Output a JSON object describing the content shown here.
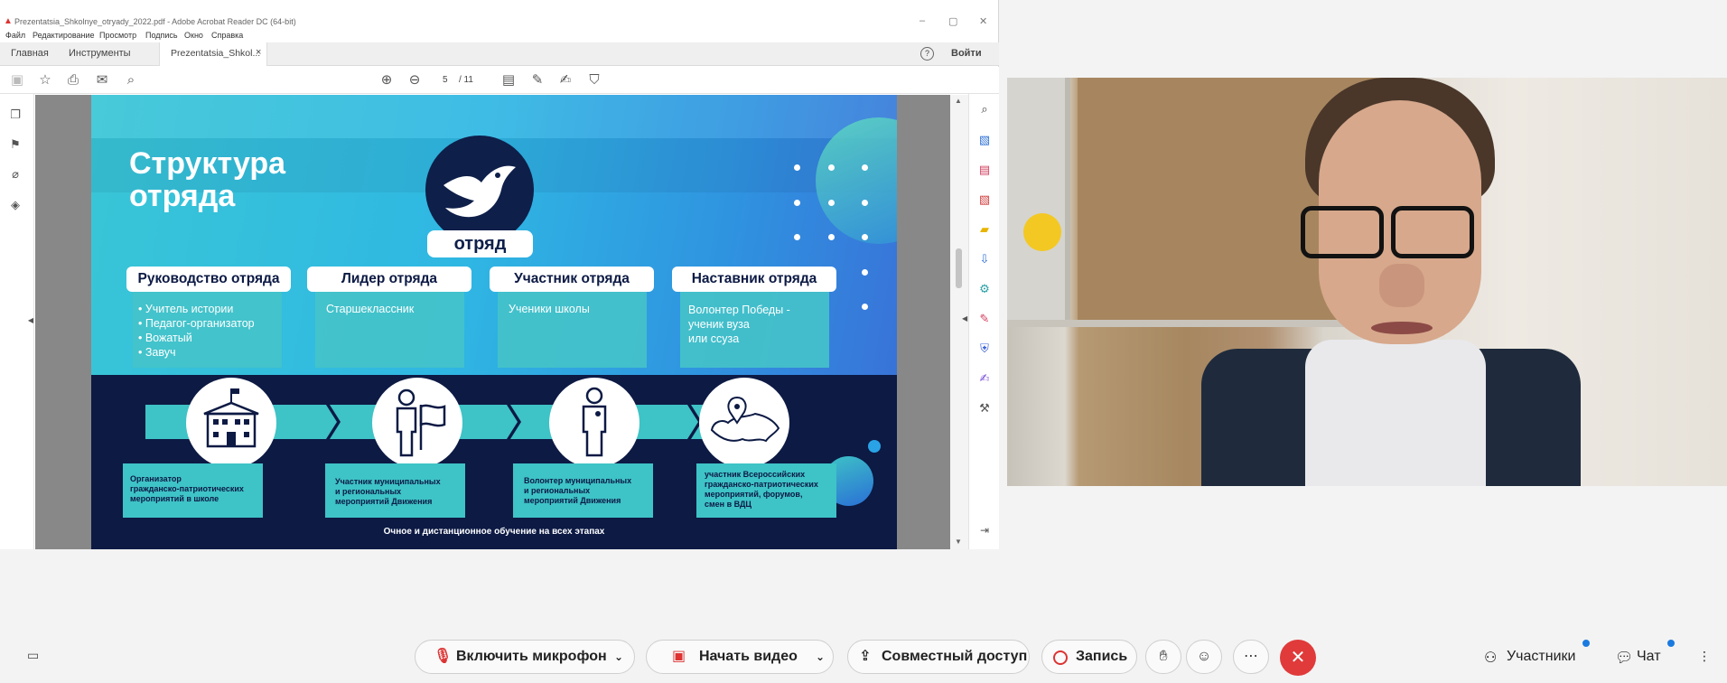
{
  "acrobat": {
    "window_title": "Prezentatsia_Shkolnye_otryady_2022.pdf - Adobe Acrobat Reader DC (64-bit)",
    "menu": [
      "Файл",
      "Редактирование",
      "Просмотр",
      "Подпись",
      "Окно",
      "Справка"
    ],
    "tabs": {
      "home": "Главная",
      "tools": "Инструменты",
      "document": "Prezentatsia_Shkol..."
    },
    "signin": "Войти",
    "page_current": "5",
    "page_total": "/ 11"
  },
  "slide": {
    "title_line1": "Структура",
    "title_line2": "отряда",
    "logo_label": "отряд",
    "columns": [
      {
        "head": "Руководство отряда",
        "lines": [
          "• Учитель истории",
          "• Педагог-организатор",
          "• Вожатый",
          "• Завуч"
        ]
      },
      {
        "head": "Лидер отряда",
        "lines": [
          "Старшеклассник"
        ]
      },
      {
        "head": "Участник отряда",
        "lines": [
          "Ученики школы"
        ]
      },
      {
        "head": "Наставник отряда",
        "lines": [
          "Волонтер Победы -",
          "ученик вуза",
          "или ссуза"
        ]
      }
    ],
    "stages": [
      [
        "Организатор",
        "гражданско-патриотических",
        "мероприятий в школе"
      ],
      [
        "Участник муниципальных",
        "и региональных",
        "мероприятий Движения"
      ],
      [
        "Волонтер муниципальных",
        "и региональных",
        "мероприятий Движения"
      ],
      [
        "участник Всероссийских",
        "гражданско-патриотических",
        "мероприятий, форумов,",
        "смен в ВДЦ"
      ]
    ],
    "footer": "Очное и дистанционное обучение на всех этапах"
  },
  "meeting": {
    "mic": "Включить микрофон",
    "video": "Начать видео",
    "share": "Совместный доступ",
    "record": "Запись",
    "participants": "Участники",
    "chat": "Чат"
  },
  "colors": {
    "slide_dark": "#0c1a44",
    "teal": "#3ec3c6",
    "end_call": "#e03a3a",
    "badge": "#1a7ae0"
  }
}
